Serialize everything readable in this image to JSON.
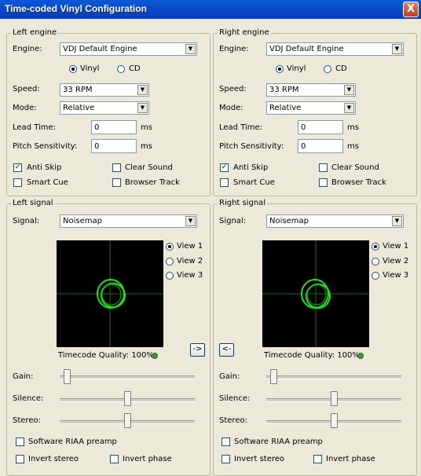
{
  "window": {
    "title": "Time-coded Vinyl Configuration",
    "close_glyph": "X"
  },
  "left": {
    "engine_group": "Left engine",
    "signal_group": "Left signal",
    "engine_label": "Engine:",
    "engine_value": "VDJ Default Engine",
    "vinyl_label": "Vinyl",
    "cd_label": "CD",
    "media_selected": "Vinyl",
    "speed_label": "Speed:",
    "speed_value": "33 RPM",
    "mode_label": "Mode:",
    "mode_value": "Relative",
    "lead_time_label": "Lead Time:",
    "lead_time_value": "0",
    "lead_time_unit": "ms",
    "pitch_label": "Pitch Sensitivity:",
    "pitch_value": "0",
    "pitch_unit": "ms",
    "anti_skip_label": "Anti Skip",
    "anti_skip_checked": true,
    "clear_sound_label": "Clear Sound",
    "smart_cue_label": "Smart Cue",
    "browser_track_label": "Browser Track",
    "signal_label": "Signal:",
    "signal_value": "Noisemap",
    "view1_label": "View 1",
    "view2_label": "View 2",
    "view3_label": "View 3",
    "view_selected": "View 1",
    "quality_text": "Timecode Quality: 100%",
    "copy_button": "->",
    "gain_label": "Gain:",
    "silence_label": "Silence:",
    "stereo_label": "Stereo:",
    "gain_level": 0.03,
    "silence_level": 0.5,
    "stereo_level": 0.5,
    "riaa_label": "Software RIAA preamp",
    "invert_stereo_label": "Invert stereo",
    "invert_phase_label": "Invert phase"
  },
  "right": {
    "engine_group": "Right engine",
    "signal_group": "Right signal",
    "engine_label": "Engine:",
    "engine_value": "VDJ Default Engine",
    "vinyl_label": "Vinyl",
    "cd_label": "CD",
    "media_selected": "Vinyl",
    "speed_label": "Speed:",
    "speed_value": "33 RPM",
    "mode_label": "Mode:",
    "mode_value": "Relative",
    "lead_time_label": "Lead Time:",
    "lead_time_value": "0",
    "lead_time_unit": "ms",
    "pitch_label": "Pitch Sensitivity:",
    "pitch_value": "0",
    "pitch_unit": "ms",
    "anti_skip_label": "Anti Skip",
    "anti_skip_checked": true,
    "clear_sound_label": "Clear Sound",
    "smart_cue_label": "Smart Cue",
    "browser_track_label": "Browser Track",
    "signal_label": "Signal:",
    "signal_value": "Noisemap",
    "view1_label": "View 1",
    "view2_label": "View 2",
    "view3_label": "View 3",
    "view_selected": "View 1",
    "quality_text": "Timecode Quality: 100%",
    "copy_button": "<-",
    "gain_label": "Gain:",
    "silence_label": "Silence:",
    "stereo_label": "Stereo:",
    "gain_level": 0.03,
    "silence_level": 0.5,
    "stereo_level": 0.5,
    "riaa_label": "Software RIAA preamp",
    "invert_stereo_label": "Invert stereo",
    "invert_phase_label": "Invert phase"
  },
  "colors": {
    "scope_grid": "#0f6b1c",
    "scope_ring": "#19e619",
    "quality_led": "#2aa52a",
    "titlebar": "#0b47c5"
  }
}
